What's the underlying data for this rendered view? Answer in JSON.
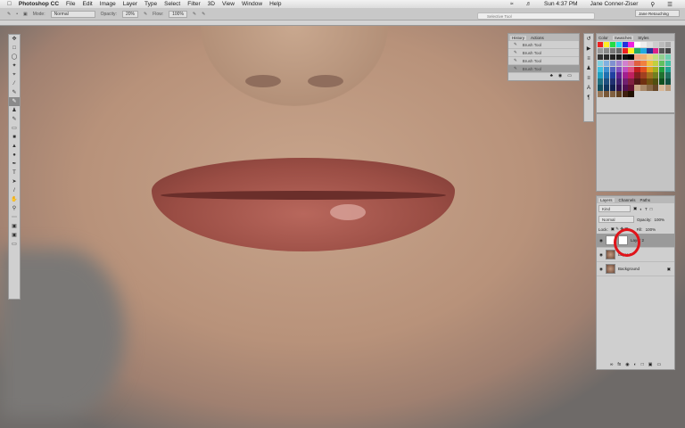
{
  "menubar": {
    "app": "Photoshop CC",
    "items": [
      "File",
      "Edit",
      "Image",
      "Layer",
      "Type",
      "Select",
      "Filter",
      "3D",
      "View",
      "Window",
      "Help"
    ],
    "clock": "Sun 4:37 PM",
    "user": "Jane Conner-Ziser"
  },
  "options": {
    "mode_label": "Mode:",
    "mode": "Normal",
    "opacity_label": "Opacity:",
    "opacity": "20%",
    "flow_label": "Flow:",
    "flow": "100%",
    "search_value": "Selective Tool",
    "workspace": "Jane Retouching"
  },
  "history": {
    "tabs": [
      "History",
      "Actions"
    ],
    "items": [
      "Brush Tool",
      "Brush Tool",
      "Brush Tool",
      "Brush Tool"
    ],
    "active_index": 3
  },
  "swatches": {
    "tabs": [
      "Color",
      "Swatches",
      "Styles"
    ],
    "colors": [
      "#ee2222",
      "#ffee22",
      "#22dd44",
      "#22ddee",
      "#2233dd",
      "#ee22dd",
      "#ffffff",
      "#eeeeee",
      "#dddddd",
      "#cccccc",
      "#bbbbbb",
      "#aaaaaa",
      "#999999",
      "#888888",
      "#777777",
      "#666666",
      "#ee2222",
      "#ffee22",
      "#22aa66",
      "#22aadd",
      "#223399",
      "#dd2288",
      "#555555",
      "#444444",
      "#333333",
      "#2a2a2a",
      "#222222",
      "#1a1a1a",
      "#111111",
      "#000000",
      "#f0a080",
      "#f0b070",
      "#f0d080",
      "#c0e080",
      "#90d090",
      "#70d0b0",
      "#80d0e0",
      "#80b0e0",
      "#8090d0",
      "#a080d0",
      "#d080d0",
      "#e080a0",
      "#e06040",
      "#f08040",
      "#f0c040",
      "#c0d040",
      "#60c060",
      "#40c0a0",
      "#40c0e0",
      "#4090d0",
      "#5060c0",
      "#8050c0",
      "#c050c0",
      "#e05080",
      "#c02020",
      "#e05020",
      "#e0a020",
      "#a0b020",
      "#20a040",
      "#20a090",
      "#20a0c0",
      "#2070b0",
      "#2040a0",
      "#602090",
      "#a02090",
      "#c02060",
      "#802020",
      "#a04020",
      "#a07020",
      "#708020",
      "#207030",
      "#207060",
      "#207080",
      "#205080",
      "#203070",
      "#402070",
      "#702070",
      "#802040",
      "#501818",
      "#703010",
      "#705010",
      "#505010",
      "#105020",
      "#105040",
      "#105060",
      "#103860",
      "#102050",
      "#301050",
      "#501050",
      "#601030",
      "#c8a888",
      "#a88868",
      "#886848",
      "#684828",
      "#d8b898",
      "#b89878",
      "#987858",
      "#785838",
      "#806040",
      "#604020",
      "#402010",
      "#201000"
    ]
  },
  "layers": {
    "tabs": [
      "Layers",
      "Channels",
      "Paths"
    ],
    "filter": "Kind",
    "blend": "Normal",
    "opacity_label": "Opacity:",
    "opacity": "100%",
    "lock_label": "Lock:",
    "fill_label": "Fill:",
    "fill": "100%",
    "items": [
      "Layer 2",
      "Layer 1",
      "Background"
    ],
    "active_index": 0
  },
  "annotation_color": "#e0141a"
}
